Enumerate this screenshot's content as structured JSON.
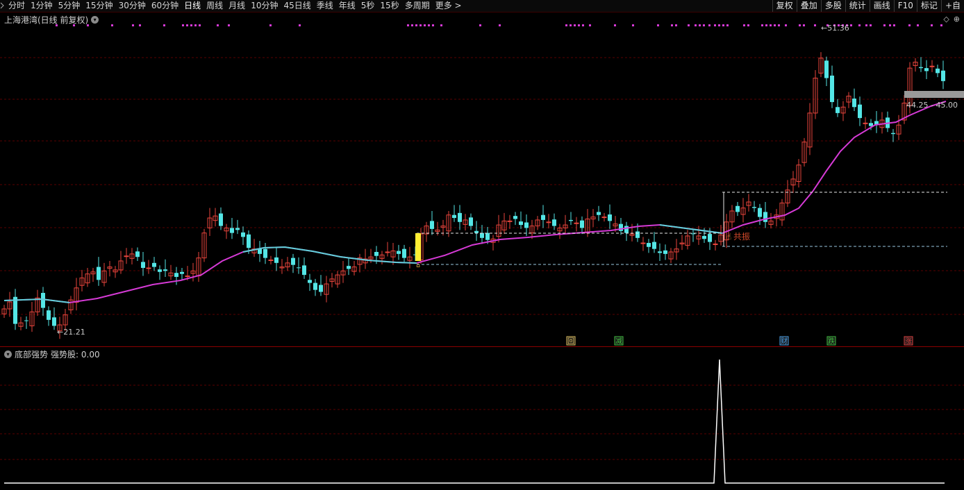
{
  "toolbar": {
    "period_tabs": [
      "分时",
      "1分钟",
      "5分钟",
      "15分钟",
      "30分钟",
      "60分钟",
      "日线",
      "周线",
      "月线",
      "10分钟",
      "45日线",
      "季线",
      "年线",
      "5秒",
      "15秒",
      "多周期",
      "更多 >"
    ],
    "active_tab": "日线",
    "right_tools": [
      "复权",
      "叠加",
      "多股",
      "统计",
      "画线",
      "F10",
      "标记",
      "+自"
    ]
  },
  "main_chart": {
    "title": "上海港湾(日线 前复权)",
    "corner_icons": [
      "◇",
      "⊕"
    ],
    "max_label": "51.36",
    "min_label": "21.21",
    "price_box_label": "44.25 - 45.00",
    "signal_label": "共振",
    "event_badges": [
      {
        "text": "回",
        "color": "#e0c060"
      },
      {
        "text": "减",
        "color": "#40c040"
      },
      {
        "text": "财",
        "color": "#4aa0e8"
      },
      {
        "text": "跌",
        "color": "#40c040"
      },
      {
        "text": "涨",
        "color": "#e04040"
      }
    ],
    "colors": {
      "up": "#e8453c",
      "down": "#54e6e6",
      "ma": "#d63ad6",
      "ma_flat": "#5fd0d8",
      "dots": "#d63ad6",
      "highlight": "#ffee33"
    }
  },
  "sub_chart": {
    "title": "底部强势",
    "series_label": "强势股: 0.00",
    "line_color": "#ffffff"
  },
  "chart_data": {
    "type": "candlestick",
    "min_price": 21.21,
    "max_price": 51.36,
    "indicator_value": 0.0
  }
}
